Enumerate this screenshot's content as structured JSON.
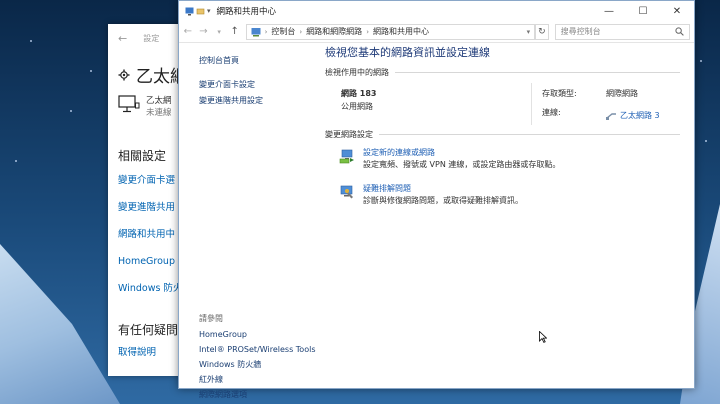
{
  "settings_window": {
    "titlebar": "設定",
    "header_title": "乙太網",
    "network_name": "乙太網",
    "network_status": "未連線",
    "section_related": "相關設定",
    "links": [
      "變更介面卡選",
      "變更進階共用",
      "網路和共用中",
      "HomeGroup",
      "Windows 防火"
    ],
    "question": "有任何疑問",
    "help_link": "取得說明"
  },
  "cp_window": {
    "title": "網路和共用中心",
    "breadcrumb": [
      "控制台",
      "網路和網際網路",
      "網路和共用中心"
    ],
    "search_placeholder": "搜尋控制台",
    "left_nav": [
      "控制台首頁",
      "變更介面卡設定",
      "變更進階共用設定"
    ],
    "see_also_head": "請參閱",
    "see_also": [
      "HomeGroup",
      "Intel® PROSet/Wireless Tools",
      "Windows 防火牆",
      "紅外線",
      "網際網路選項"
    ],
    "heading": "檢視您基本的網路資訊並設定連線",
    "active_networks_label": "檢視作用中的網路",
    "network": {
      "name": "網路 183",
      "type": "公用網路",
      "access_type_label": "存取類型:",
      "access_type_value": "網際網路",
      "connections_label": "連線:",
      "connections_value": "乙太網路 3"
    },
    "change_settings_label": "變更網路設定",
    "tasks": [
      {
        "link": "設定新的連線或網路",
        "desc": "設定寬頻、撥號或 VPN 連線，或設定路由器或存取點。"
      },
      {
        "link": "疑難排解問題",
        "desc": "診斷與修復網路問題，或取得疑難排解資訊。"
      }
    ]
  },
  "colors": {
    "link": "#1e5fb4",
    "heading": "#1e3a78",
    "settings_link": "#0063b1"
  }
}
